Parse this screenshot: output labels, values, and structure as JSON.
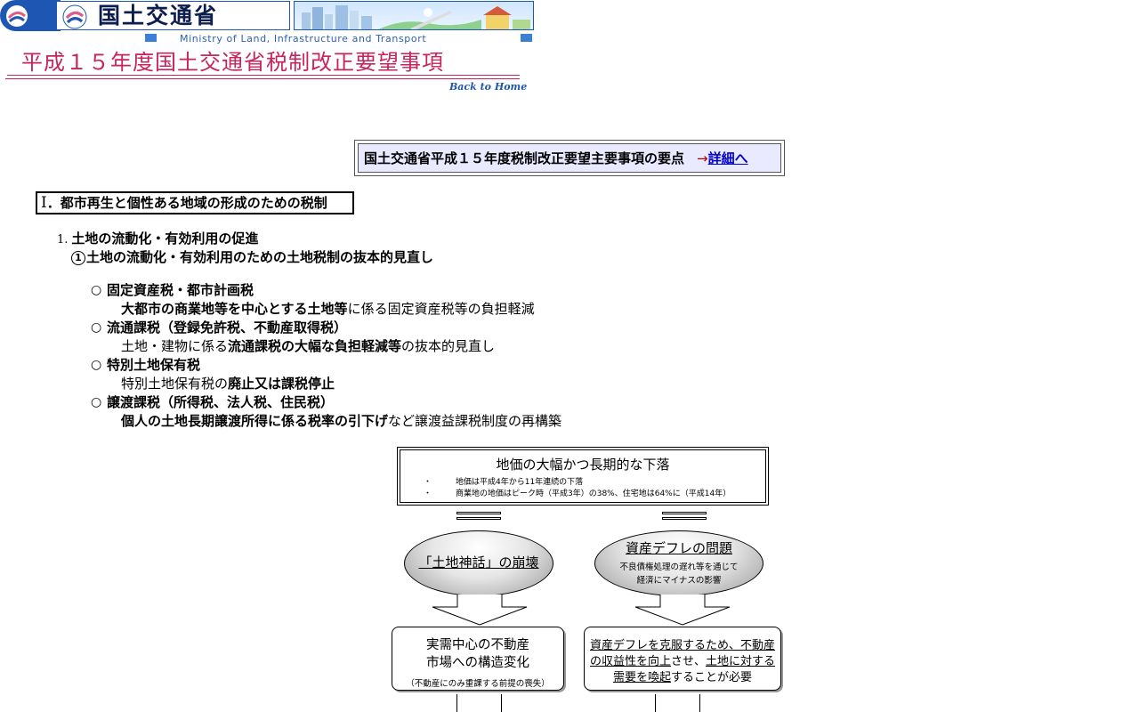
{
  "header": {
    "ministry_jp": "国土交通省",
    "ministry_en": "Ministry of Land, Infrastructure and Transport",
    "page_title": "平成１５年度国土交通省税制改正要望事項",
    "back_home": "Back to Home"
  },
  "summary": {
    "text": "国土交通省平成１５年度税制改正要望主要事項の要点",
    "arrow": "→",
    "link_label": "詳細へ"
  },
  "section": {
    "roman": "Ⅰ",
    "title": "．都市再生と個性ある地域の形成のための税制",
    "sub1_num": "1.",
    "sub1_title": "土地の流動化・有効利用の促進",
    "sub2_num": "1",
    "sub2_title": "土地の流動化・有効利用のための土地税制の抜本的見直し",
    "items": [
      {
        "bullet": "○",
        "head": "固定資産税・都市計画税",
        "body_bold": "大都市の商業地等を中心とする土地等",
        "body_plain": "に係る固定資産税等の負担軽減"
      },
      {
        "bullet": "○",
        "head": "流通課税（登録免許税、不動産取得税）",
        "body_plain1": "土地・建物に係る",
        "body_bold": "流通課税の大幅な負担軽減等",
        "body_plain2": "の抜本的見直し"
      },
      {
        "bullet": "○",
        "head": "特別土地保有税",
        "body_plain": "特別土地保有税の",
        "body_bold": "廃止又は課税停止"
      },
      {
        "bullet": "○",
        "head": "譲渡課税（所得税、法人税、住民税）",
        "body_bold": "個人の土地長期譲渡所得に係る税率の引下げ",
        "body_plain": "など譲渡益課税制度の再構築"
      }
    ]
  },
  "diagram": {
    "top_title": "地価の大幅かつ長期的な下落",
    "top_bullet": "・",
    "top_line1": "地価は平成4年から11年連続の下落",
    "top_line2": "商業地の地価はピーク時（平成3年）の38%、住宅地は64%に（平成14年）",
    "left_ellipse": "「土地神話」の崩壊",
    "right_ellipse_title": "資産デフレの問題",
    "right_ellipse_line1": "不良債権処理の遅れ等を通じて",
    "right_ellipse_line2": "経済にマイナスの影響",
    "left_box_line1": "実需中心の不動産",
    "left_box_line2": "市場への構造変化",
    "left_box_note": "（不動産にのみ重課する前提の喪失）",
    "right_box_p1": "資産デフレを克服するため、",
    "right_box_p2": "不動産",
    "right_box_p3": "の収益性を向上",
    "right_box_p4": "させ、",
    "right_box_p5": "土地に対する",
    "right_box_p6": "需要を喚起",
    "right_box_p7": "することが必要"
  },
  "colors": {
    "accent_blue": "#1e56b4",
    "title_crimson": "#c8235a",
    "link_blue": "#0000d0",
    "summary_bg": "#e9e9ff"
  }
}
